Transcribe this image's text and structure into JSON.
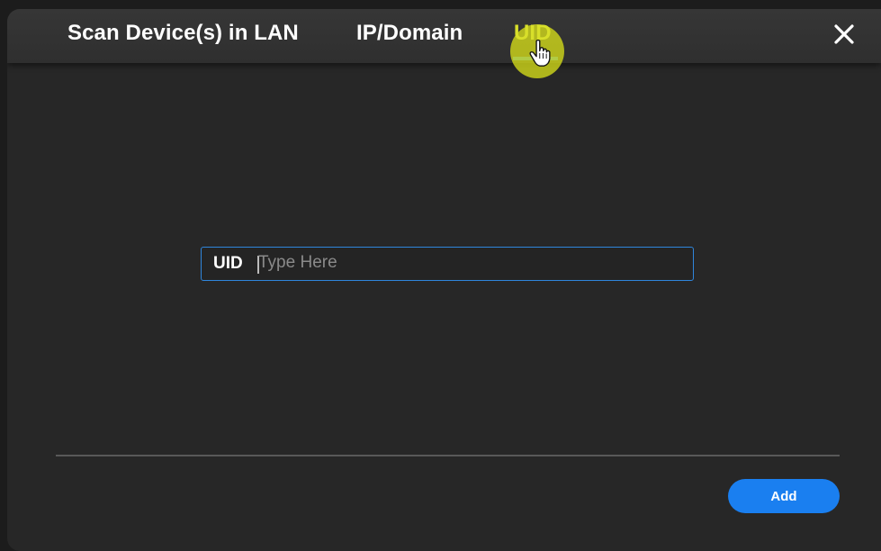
{
  "tabs": [
    {
      "label": "Scan Device(s) in LAN"
    },
    {
      "label": "IP/Domain"
    },
    {
      "label": "UID",
      "active": true
    }
  ],
  "icons": {
    "close": "close-icon",
    "cursor": "hand-pointer-icon"
  },
  "form": {
    "uid_label": "UID",
    "uid_value": "",
    "uid_placeholder": "Type Here"
  },
  "footer": {
    "add_label": "Add"
  },
  "colors": {
    "background": "#272727",
    "header": "#363636",
    "active_tab": "#d8df2a",
    "accent": "#1a7ff0",
    "cursor_highlight": "#d6de1a"
  }
}
